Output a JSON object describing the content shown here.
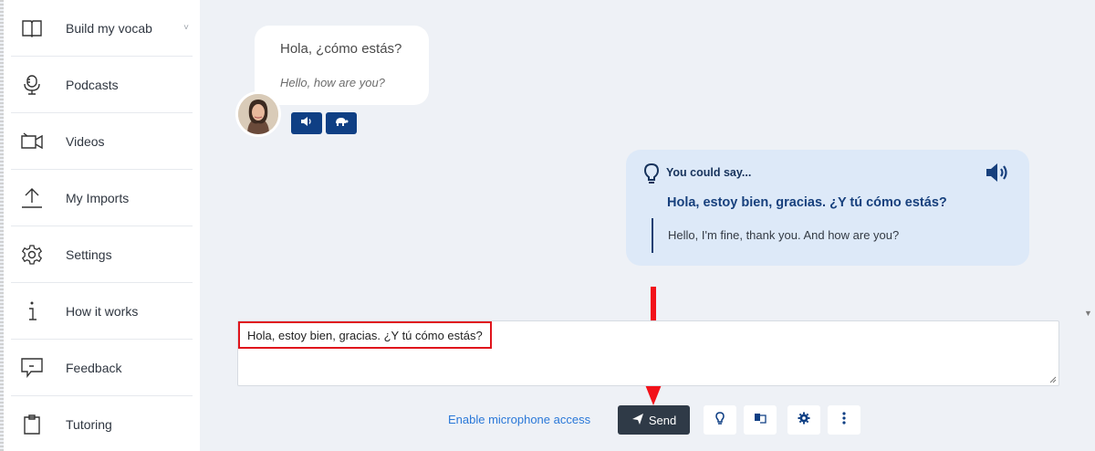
{
  "sidebar": {
    "items": [
      {
        "label": "Build my vocab",
        "icon": "book-icon",
        "chevron": "˅"
      },
      {
        "label": "Podcasts",
        "icon": "microphone-icon"
      },
      {
        "label": "Videos",
        "icon": "video-camera-icon"
      },
      {
        "label": "My Imports",
        "icon": "upload-icon"
      },
      {
        "label": "Settings",
        "icon": "gear-icon"
      },
      {
        "label": "How it works",
        "icon": "info-icon"
      },
      {
        "label": "Feedback",
        "icon": "feedback-bubble-icon"
      },
      {
        "label": "Tutoring",
        "icon": "clipboard-icon"
      }
    ]
  },
  "chat": {
    "tutor_message": {
      "spanish": "Hola, ¿cómo estás?",
      "english": "Hello, how are you?"
    },
    "suggestion": {
      "heading": "You could say...",
      "spanish": "Hola, estoy bien, gracias. ¿Y tú cómo estás?",
      "english": "Hello, I'm fine, thank you. And how are you?"
    }
  },
  "composer": {
    "value": "Hola, estoy bien, gracias. ¿Y tú cómo estás?",
    "mic_link": "Enable microphone access",
    "send_label": "Send"
  },
  "colors": {
    "accent": "#0f3f84",
    "send": "#2f3a47",
    "highlight": "#e0141c",
    "link": "#2a78d8"
  }
}
